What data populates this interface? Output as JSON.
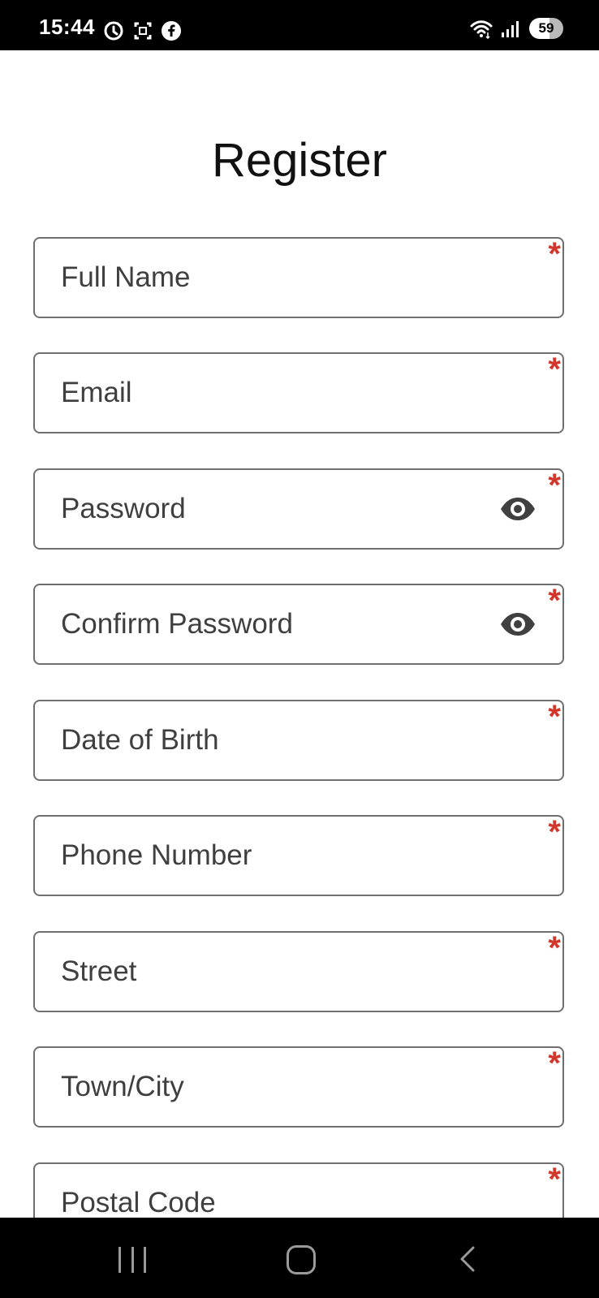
{
  "status_bar": {
    "time": "15:44",
    "battery": "59"
  },
  "page": {
    "title": "Register"
  },
  "form": {
    "fields": [
      {
        "label": "Full Name",
        "required_marker": "*"
      },
      {
        "label": "Email",
        "required_marker": "*"
      },
      {
        "label": "Password",
        "required_marker": "*",
        "icon": "eye-icon"
      },
      {
        "label": "Confirm Password",
        "required_marker": "*",
        "icon": "eye-icon"
      },
      {
        "label": "Date of Birth",
        "required_marker": "*"
      },
      {
        "label": "Phone Number",
        "required_marker": "*"
      },
      {
        "label": "Street",
        "required_marker": "*"
      },
      {
        "label": "Town/City",
        "required_marker": "*"
      },
      {
        "label": "Postal Code",
        "required_marker": "*"
      }
    ]
  },
  "colors": {
    "required": "#d2372c",
    "border": "#6f6f6f",
    "text": "#3f3f3f"
  }
}
